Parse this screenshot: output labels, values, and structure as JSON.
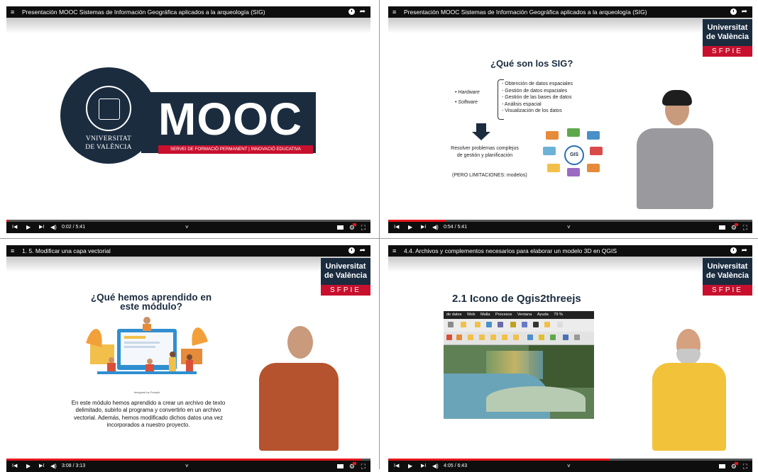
{
  "players": [
    {
      "title": "Presentación MOOC Sistemas de Información Geográfica aplicados a la arqueología (SIG)",
      "time": "0:02 / 5:41",
      "progress": 0.006,
      "slide": {
        "university_line1": "VNIVERSITAT",
        "university_line2": "DE VALÈNCIA",
        "brand": "MOOC",
        "tagline": "SERVEI DE FORMACIÓ PERMANENT | INNOVACIÓ EDUCATIVA"
      }
    },
    {
      "title": "Presentación MOOC Sistemas de Información Geográfica aplicados a la arqueología (SIG)",
      "time": "0:54 / 5:41",
      "progress": 0.158,
      "slide": {
        "heading": "¿Qué son los SIG?",
        "hardware": "Hardware",
        "software": "Software",
        "items": [
          "- Obtención de datos espaciales",
          "- Gestión de datos espaciales",
          "- Gestión de las bases de datos",
          "- Análisis espacial",
          "- Visualización de los datos"
        ],
        "resolve": "Resolver problemas complejos de gestión y planificación",
        "limits": "(PERO LIMITACIONES: modelos)",
        "gis_label": "GIS"
      }
    },
    {
      "title": "1. 5. Modificar una capa vectorial",
      "time": "3:08 / 3:13",
      "progress": 0.974,
      "slide": {
        "heading": "¿Qué hemos aprendido en este módulo?",
        "credit": "designed by Freepik",
        "body": "En este módulo hemos aprendido a crear un archivo de texto delimitado, subirlo al programa y convertirlo en un archivo vectorial. Además, hemos modificado dichos datos una vez incorporados a nuestro proyecto."
      }
    },
    {
      "title": "4.4. Archivos y complementos necesarios para elaborar un modelo 3D en QGIS",
      "time": "4:05 / 6:43",
      "progress": 0.608,
      "slide": {
        "heading": "2.1 Icono de Qgis2threejs",
        "menu": [
          "de datos",
          "Web",
          "Malla",
          "Procesos",
          "Ventana",
          "Ayuda"
        ],
        "zoom": "79 %"
      }
    }
  ],
  "badge": {
    "line1": "Universitat",
    "line2": "de València",
    "unit": "SFPIE"
  },
  "colors": {
    "navy": "#1b2c3f",
    "red": "#c8102e",
    "progress": "#e3161b"
  }
}
